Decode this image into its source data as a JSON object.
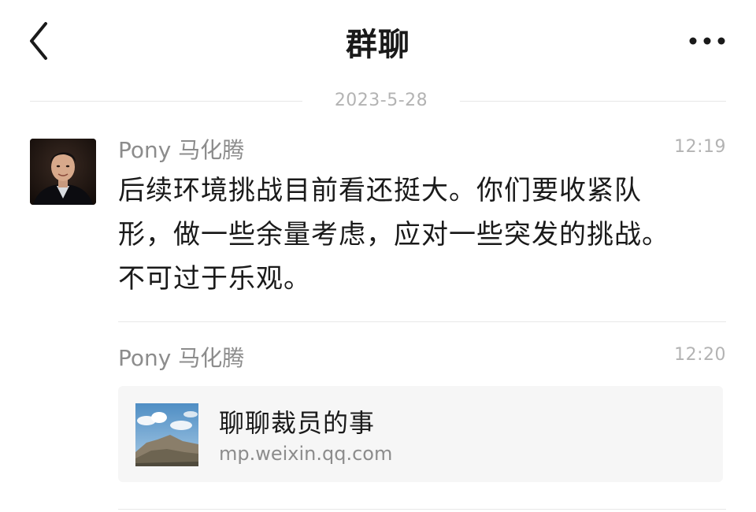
{
  "header": {
    "title": "群聊",
    "back_icon": "chevron-left-icon",
    "more_icon": "more-horizontal-icon"
  },
  "date_divider": "2023-5-28",
  "messages": [
    {
      "sender": "Pony 马化腾",
      "time": "12:19",
      "lines": [
        "后续环境挑战目前看还挺大。你们要收紧队",
        "形，做一些余量考虑，应对一些突发的挑战。",
        "不可过于乐观。"
      ]
    },
    {
      "sender": "Pony 马化腾",
      "time": "12:20",
      "link_card": {
        "title": "聊聊裁员的事",
        "url": "mp.weixin.qq.com",
        "thumbnail": "landscape-thumbnail"
      }
    }
  ],
  "colors": {
    "background": "#ffffff",
    "meta_gray": "#b3b3b3",
    "sender_gray": "#8c8c8c",
    "card_bg": "#f6f6f6"
  }
}
